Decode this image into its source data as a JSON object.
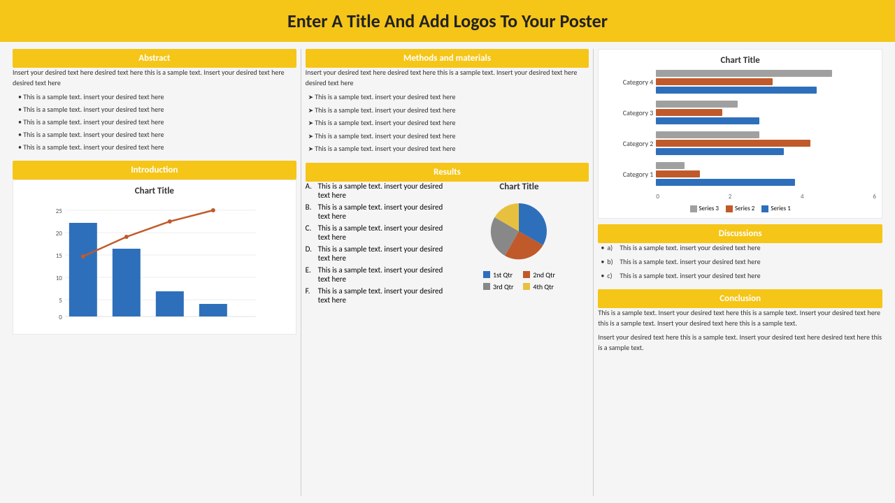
{
  "header": {
    "title": "Enter A Title And Add Logos To Your Poster"
  },
  "colors": {
    "yellow": "#F5C518",
    "blue": "#2e6fbb",
    "orange": "#c05a2a",
    "gray": "#a0a0a0",
    "pie1": "#2e6fbb",
    "pie2": "#c05a2a",
    "pie3": "#888",
    "pie4": "#e8c040"
  },
  "col1": {
    "abstract": {
      "header": "Abstract",
      "intro": "Insert your desired text here desired text here this is a sample text. Insert your desired text here desired text here",
      "items": [
        "This is a sample text. insert your desired text here",
        "This is a sample text. insert your desired text here",
        "This is a sample text. insert your desired text here",
        "This is a sample text. insert your desired text here",
        "This is a sample text. insert your desired text here"
      ]
    },
    "introduction": {
      "header": "Introduction",
      "chart_title": "Chart Title",
      "y_axis": [
        "25",
        "20",
        "15",
        "10",
        "5",
        "0"
      ],
      "x_labels": [
        "",
        "",
        "",
        "",
        ""
      ]
    }
  },
  "col2": {
    "methods": {
      "header": "Methods and materials",
      "intro": "Insert your desired text here desired text here this is a sample text. Insert your desired text here desired text here",
      "items": [
        "This is a sample text. insert your desired text here",
        "This is a sample text. insert your desired text here",
        "This is a sample text. insert your desired text here",
        "This is a sample text. insert your desired text here",
        "This is a sample text. insert your desired text here"
      ]
    },
    "results": {
      "header": "Results",
      "items": [
        {
          "label": "A.",
          "text": "This is a sample text. insert your desired text here"
        },
        {
          "label": "B.",
          "text": "This is a sample text. insert your desired text here"
        },
        {
          "label": "C.",
          "text": "This is a sample text. insert your desired text here"
        },
        {
          "label": "D.",
          "text": "This is a sample text. insert your desired text here"
        },
        {
          "label": "E.",
          "text": "This is a sample text. insert your desired text here"
        },
        {
          "label": "F.",
          "text": "This is a sample text. insert your desired text here"
        }
      ],
      "chart_title": "Chart Title",
      "pie_legend": [
        {
          "label": "1st Qtr",
          "color": "#2e6fbb"
        },
        {
          "label": "2nd Qtr",
          "color": "#c05a2a"
        },
        {
          "label": "3rd Qtr",
          "color": "#888"
        },
        {
          "label": "4th Qtr",
          "color": "#e8c040"
        }
      ]
    }
  },
  "col3": {
    "chart": {
      "title": "Chart Title",
      "categories": [
        "Category 4",
        "Category 3",
        "Category 2",
        "Category 1"
      ],
      "series": [
        {
          "name": "Series 1",
          "color": "#2e6fbb",
          "values": [
            4.4,
            2.8,
            3.5,
            3.8
          ]
        },
        {
          "name": "Series 2",
          "color": "#c05a2a",
          "values": [
            3.2,
            1.8,
            4.2,
            1.2
          ]
        },
        {
          "name": "Series 3",
          "color": "#a0a0a0",
          "values": [
            4.8,
            2.2,
            2.8,
            0.8
          ]
        }
      ],
      "x_axis": [
        "0",
        "2",
        "4",
        "6"
      ]
    },
    "discussions": {
      "header": "Discussions",
      "items": [
        {
          "label": "a)",
          "text": "This is a sample text. insert your desired text here"
        },
        {
          "label": "b)",
          "text": "This is a sample text. insert your desired text here"
        },
        {
          "label": "c)",
          "text": "This is a sample text. insert your desired text here"
        }
      ]
    },
    "conclusion": {
      "header": "Conclusion",
      "paragraphs": [
        "This is a sample text. Insert your desired text here this is a sample text. Insert your desired text here this is a sample text. Insert your desired text here this is a sample text.",
        "Insert your desired text here this is a sample text. Insert your desired text here desired text here this is a sample text."
      ]
    }
  }
}
